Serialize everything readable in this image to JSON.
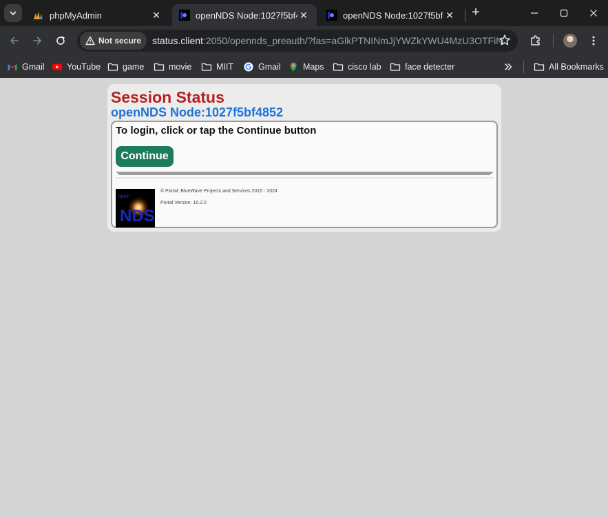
{
  "browser": {
    "tabs": [
      {
        "title": "phpMyAdmin",
        "active": false
      },
      {
        "title": "openNDS Node:1027f5bf4852",
        "active": true
      },
      {
        "title": "openNDS Node:1027f5bf4852",
        "active": false
      }
    ],
    "security_label": "Not secure",
    "url_host": "status.client",
    "url_rest": ":2050/opennds_preauth/?fas=aGlkPTNINmJjYWZkYWU4MzU3OTFiNzA5ZT...",
    "bookmarks": [
      {
        "label": "Gmail",
        "icon": "gmail-icon"
      },
      {
        "label": "YouTube",
        "icon": "youtube-icon"
      },
      {
        "label": "game",
        "icon": "folder-icon"
      },
      {
        "label": "movie",
        "icon": "folder-icon"
      },
      {
        "label": "MIIT",
        "icon": "folder-icon"
      },
      {
        "label": "Gmail",
        "icon": "google-icon"
      },
      {
        "label": "Maps",
        "icon": "maps-icon"
      },
      {
        "label": "cisco lab",
        "icon": "folder-icon"
      },
      {
        "label": "face detecter",
        "icon": "folder-icon"
      }
    ],
    "all_bookmarks": "All Bookmarks"
  },
  "page": {
    "title": "Session Status",
    "node": "openNDS Node:1027f5bf4852",
    "prompt": "To login, click or tap the Continue button",
    "continue_label": "Continue",
    "copyright": "© Portal: BlueWave Projects and Services 2015 - 2024",
    "version": "Portal Version: 10.2.0",
    "logo_text": "NDS"
  },
  "colors": {
    "title": "#b71f1f",
    "node": "#1f73d6",
    "button": "#1e7c5e",
    "page_bg": "#d4d4d4"
  }
}
